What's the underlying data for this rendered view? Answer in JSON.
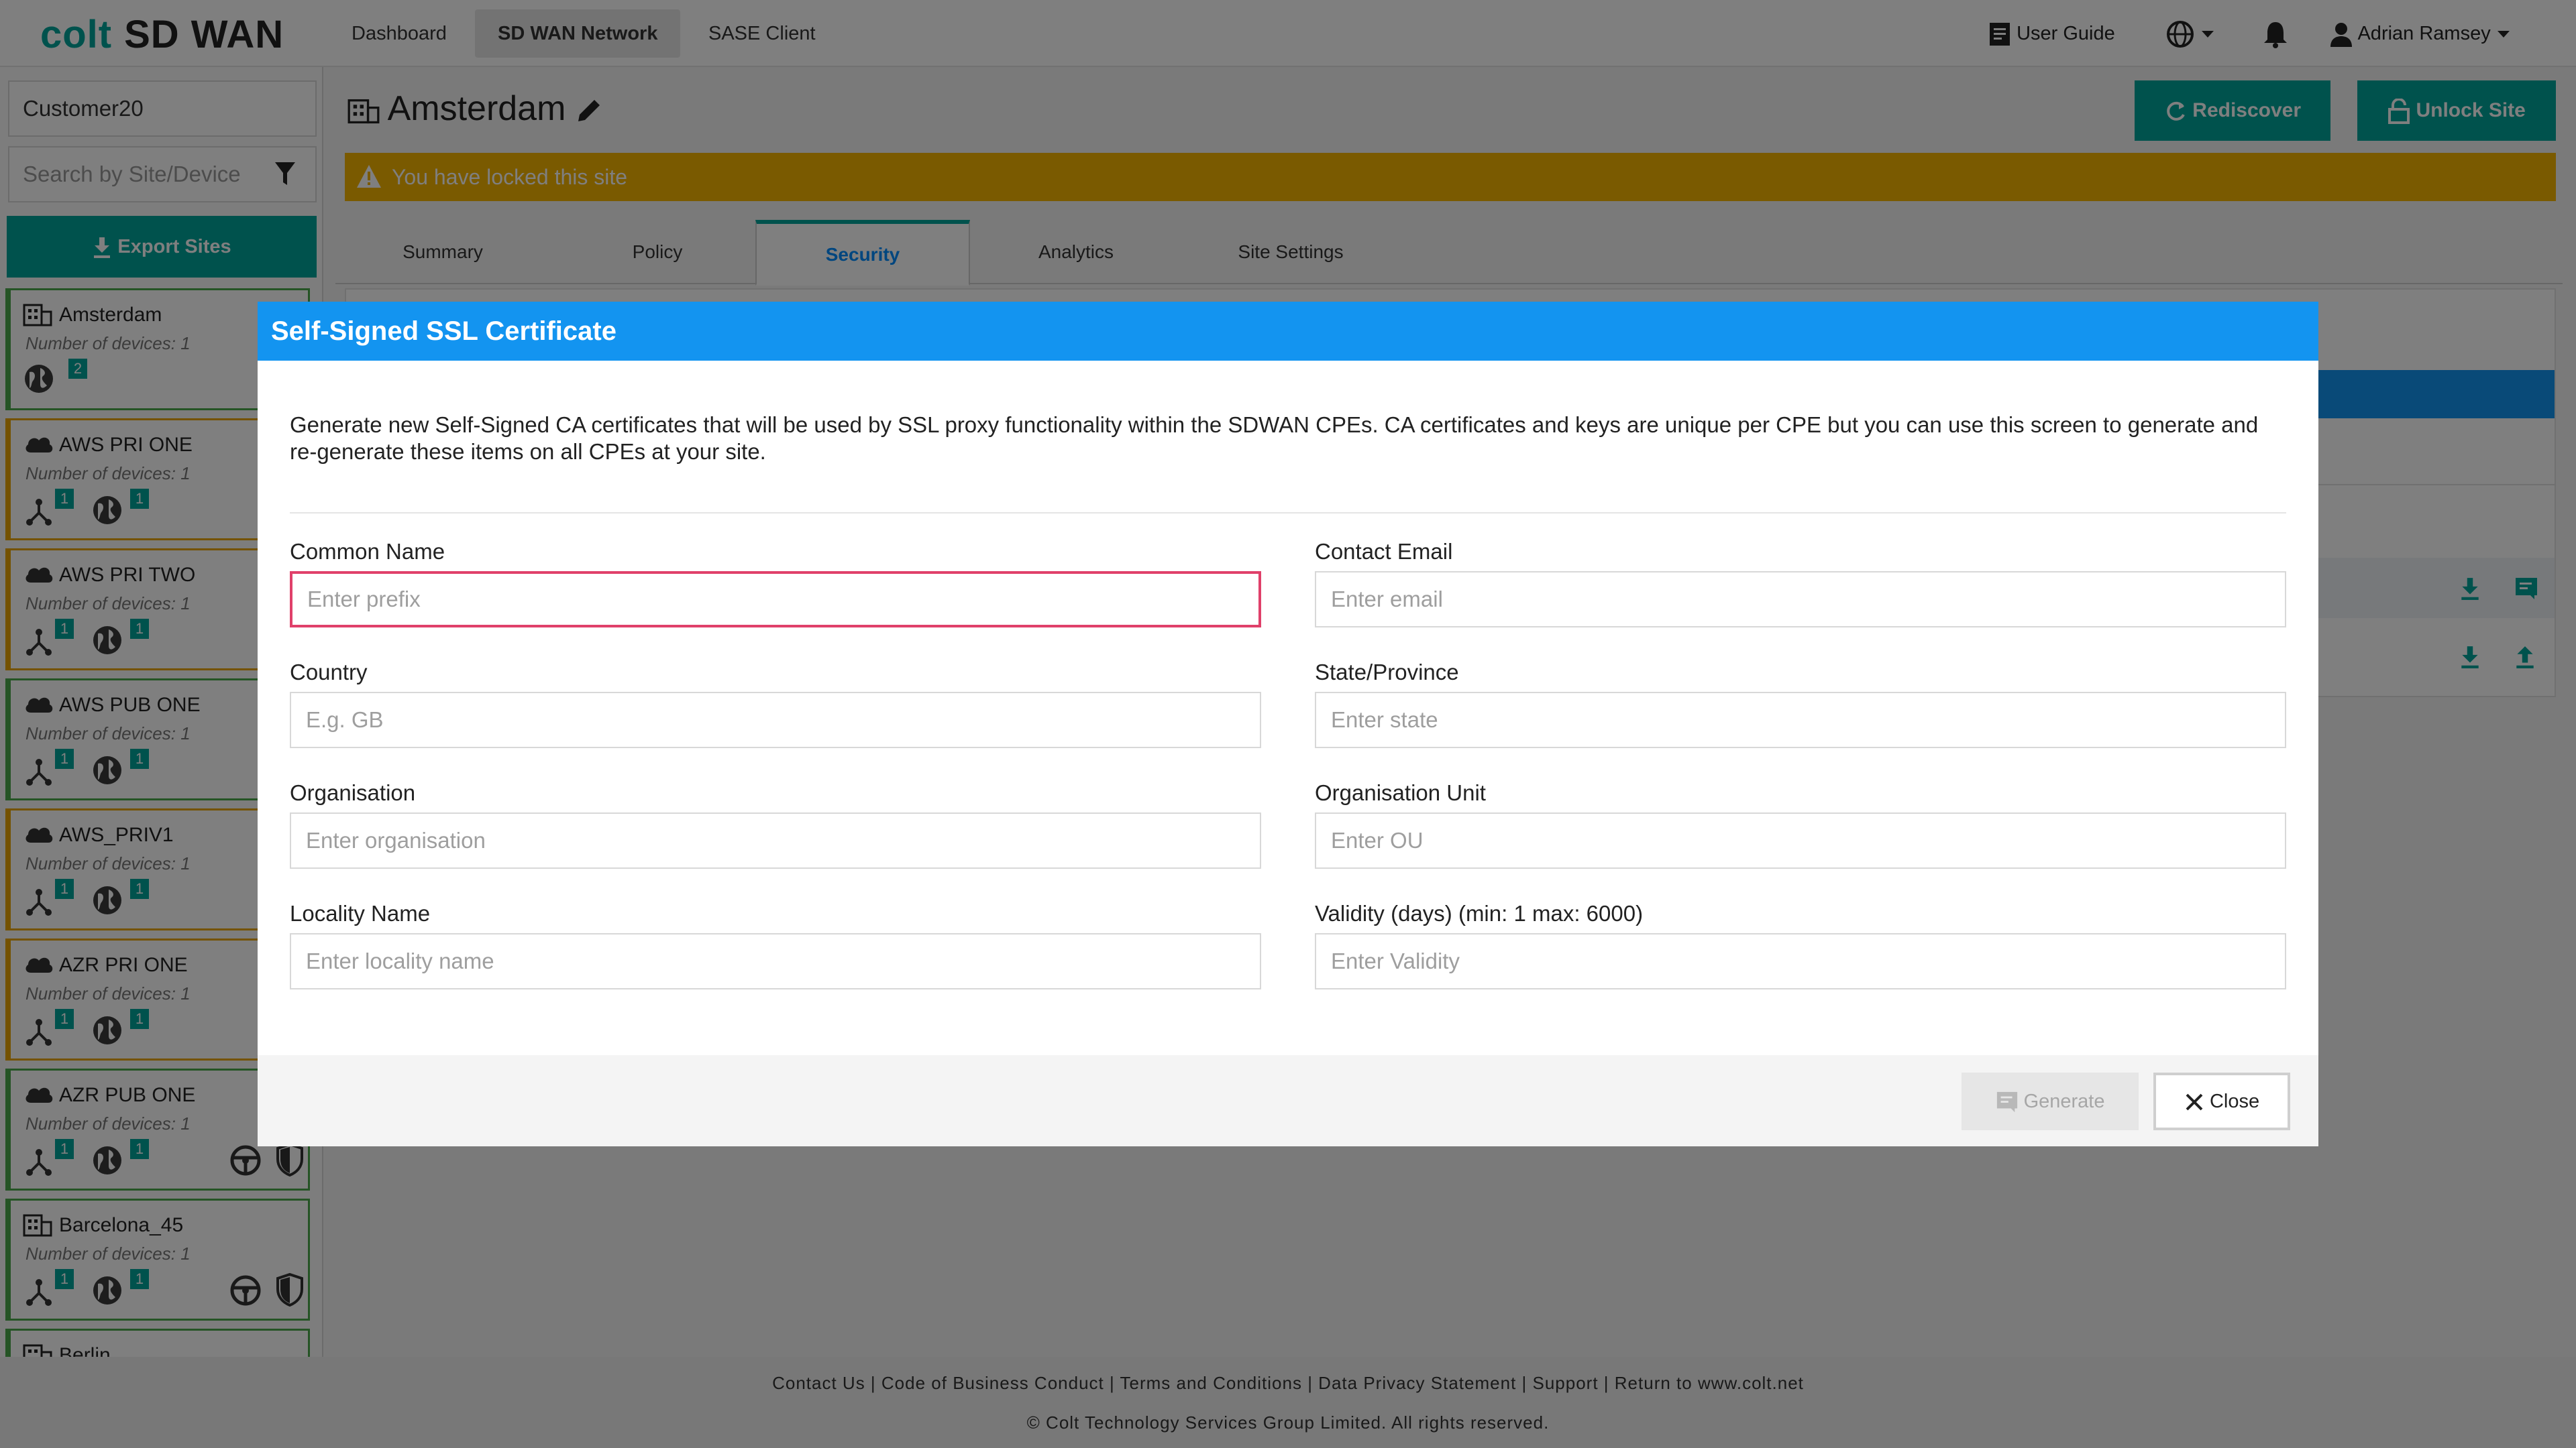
{
  "app": {
    "logo_colt": "colt",
    "logo_product": "SD WAN"
  },
  "nav": {
    "items": [
      {
        "label": "Dashboard"
      },
      {
        "label": "SD WAN Network"
      },
      {
        "label": "SASE Client"
      }
    ],
    "user_guide": "User Guide",
    "user_name": "Adrian Ramsey"
  },
  "sidebar": {
    "customer": "Customer20",
    "search_placeholder": "Search by Site/Device",
    "export_label": "Export Sites",
    "sites": [
      {
        "name": "Amsterdam",
        "devices": "Number of devices: 1",
        "type": "building",
        "status": "green",
        "badge1": "2"
      },
      {
        "name": "AWS PRI ONE",
        "devices": "Number of devices: 1",
        "type": "cloud",
        "status": "orange",
        "badge1": "1",
        "badge2": "1"
      },
      {
        "name": "AWS PRI TWO",
        "devices": "Number of devices: 1",
        "type": "cloud",
        "status": "orange",
        "badge1": "1",
        "badge2": "1"
      },
      {
        "name": "AWS PUB ONE",
        "devices": "Number of devices: 1",
        "type": "cloud",
        "status": "green",
        "badge1": "1",
        "badge2": "1"
      },
      {
        "name": "AWS_PRIV1",
        "devices": "Number of devices: 1",
        "type": "cloud",
        "status": "orange",
        "badge1": "1",
        "badge2": "1"
      },
      {
        "name": "AZR PRI ONE",
        "devices": "Number of devices: 1",
        "type": "cloud",
        "status": "orange",
        "badge1": "1",
        "badge2": "1"
      },
      {
        "name": "AZR PUB ONE",
        "devices": "Number of devices: 1",
        "type": "cloud",
        "status": "green",
        "badge1": "1",
        "badge2": "1"
      },
      {
        "name": "Barcelona_45",
        "devices": "Number of devices: 1",
        "type": "building",
        "status": "green",
        "badge1": "1",
        "badge2": "1"
      },
      {
        "name": "Berlin",
        "devices": "",
        "type": "building",
        "status": "green"
      }
    ]
  },
  "main": {
    "title": "Amsterdam",
    "rediscover_label": "Rediscover",
    "unlock_label": "Unlock Site",
    "lock_banner": "You have locked this site",
    "tabs": [
      {
        "label": "Summary"
      },
      {
        "label": "Policy"
      },
      {
        "label": "Security"
      },
      {
        "label": "Analytics"
      },
      {
        "label": "Site Settings"
      }
    ]
  },
  "modal": {
    "title": "Self-Signed SSL Certificate",
    "description": "Generate new Self-Signed CA certificates that will be used by SSL proxy functionality within the SDWAN CPEs. CA certificates and keys are unique per CPE but you can use this screen to generate and re-generate these items on all CPEs at your site.",
    "fields": {
      "common_name": {
        "label": "Common Name",
        "placeholder": "Enter prefix"
      },
      "contact_email": {
        "label": "Contact Email",
        "placeholder": "Enter email"
      },
      "country": {
        "label": "Country",
        "placeholder": "E.g. GB"
      },
      "state": {
        "label": "State/Province",
        "placeholder": "Enter state"
      },
      "organisation": {
        "label": "Organisation",
        "placeholder": "Enter organisation"
      },
      "org_unit": {
        "label": "Organisation Unit",
        "placeholder": "Enter OU"
      },
      "locality": {
        "label": "Locality Name",
        "placeholder": "Enter locality name"
      },
      "validity": {
        "label": "Validity (days) (min: 1 max: 6000)",
        "placeholder": "Enter Validity"
      }
    },
    "generate_label": "Generate",
    "close_label": "Close"
  },
  "footer": {
    "links": [
      "Contact Us",
      "Code of Business Conduct",
      "Terms and Conditions",
      "Data Privacy Statement",
      "Support",
      "Return to www.colt.net"
    ],
    "copyright": "© Colt Technology Services Group Limited. All rights reserved."
  },
  "colors": {
    "brand_teal": "#00a59b",
    "modal_header": "#1394f0",
    "lock_banner": "#f5b400",
    "error_border": "#e0406a"
  }
}
